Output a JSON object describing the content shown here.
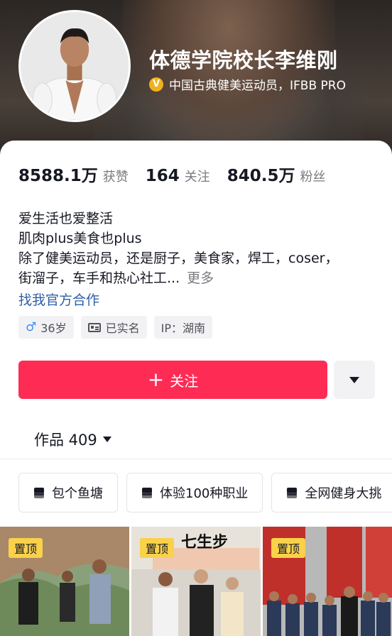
{
  "profile": {
    "name": "体德学院校长李维刚",
    "verification": "中国古典健美运动员，IFBB PRO",
    "verify_icon": "verified-v-icon",
    "verify_color": "#f0b21c"
  },
  "stats": [
    {
      "value": "8588.1万",
      "label": "获赞"
    },
    {
      "value": "164",
      "label": "关注"
    },
    {
      "value": "840.5万",
      "label": "粉丝"
    }
  ],
  "bio": {
    "lines": [
      "爱生活也爱整活",
      "肌肉plus美食也plus",
      "除了健美运动员，还是厨子，美食家，焊工，coser，",
      "街溜子，车手和热心社工..."
    ],
    "more": "更多",
    "collab": "找我官方合作"
  },
  "tags": {
    "gender_icon": "♂",
    "age": "36岁",
    "realname": "已实名",
    "ip": "IP：湖南"
  },
  "actions": {
    "follow_plus": "+",
    "follow_label": "关注",
    "follow_color": "#fe2c55"
  },
  "works": {
    "label": "作品 409"
  },
  "collections": [
    {
      "label": "包个鱼塘"
    },
    {
      "label": "体验100种职业"
    },
    {
      "label": "全网健身大挑"
    }
  ],
  "videos": [
    {
      "pinned": "置顶"
    },
    {
      "pinned": "置顶",
      "sign": "七生步"
    },
    {
      "pinned": "置顶"
    }
  ]
}
